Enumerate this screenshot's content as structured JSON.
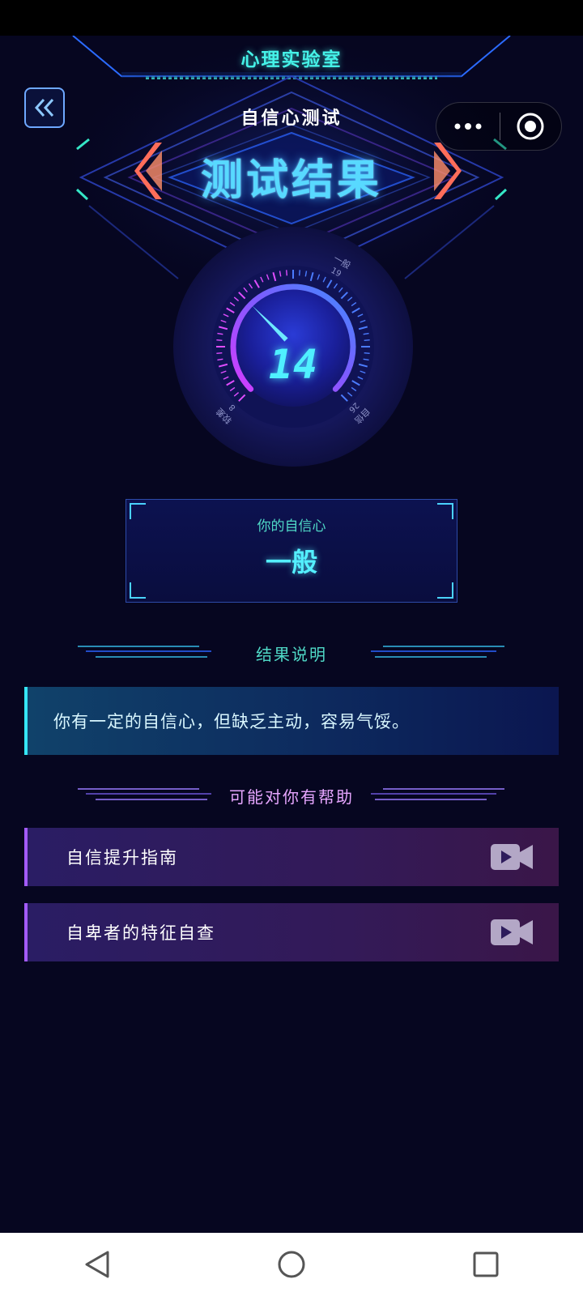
{
  "app": {
    "title": "心理实验室"
  },
  "header": {
    "subtitle": "自信心测试",
    "title": "测试结果"
  },
  "gauge": {
    "score": "14",
    "min": 8,
    "max": 26,
    "labels": [
      {
        "value": "8",
        "text": "较差"
      },
      {
        "value": "19",
        "text": "一般"
      },
      {
        "value": "26",
        "text": "自信"
      }
    ]
  },
  "result": {
    "label": "你的自信心",
    "level": "一般"
  },
  "explanation": {
    "heading": "结果说明",
    "text": "你有一定的自信心，但缺乏主动，容易气馁。"
  },
  "help": {
    "heading": "可能对你有帮助",
    "items": [
      {
        "label": "自信提升指南",
        "icon": "video-icon"
      },
      {
        "label": "自卑者的特征自查",
        "icon": "video-icon"
      }
    ]
  },
  "colors": {
    "background": "#060620",
    "accent_cyan": "#45f2e8",
    "accent_blue": "#58d9ff",
    "accent_purple": "#a35bff"
  }
}
